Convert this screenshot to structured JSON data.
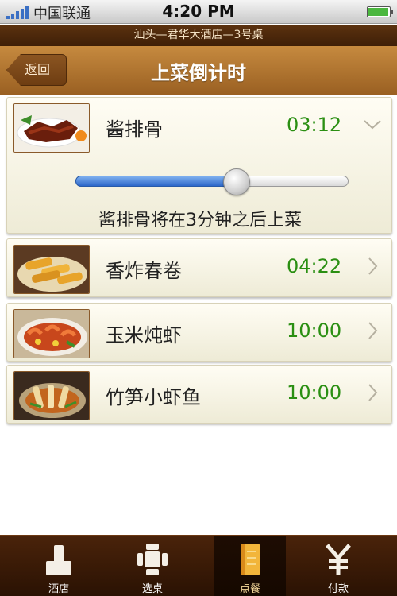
{
  "status_bar": {
    "carrier": "中国联通",
    "time": "4:20 PM"
  },
  "location": "汕头—君华大酒店—3号桌",
  "nav": {
    "back_label": "返回",
    "title": "上菜倒计时"
  },
  "dishes": [
    {
      "name": "酱排骨",
      "time": "03:12",
      "expanded": true,
      "slider_progress": 0.59,
      "note": "酱排骨将在3分钟之后上菜"
    },
    {
      "name": "香炸春卷",
      "time": "04:22"
    },
    {
      "name": "玉米炖虾",
      "time": "10:00"
    },
    {
      "name": "竹笋小虾鱼",
      "time": "10:00"
    }
  ],
  "tabs": [
    {
      "label": "酒店",
      "icon": "hotel-icon"
    },
    {
      "label": "选桌",
      "icon": "table-icon"
    },
    {
      "label": "点餐",
      "icon": "menu-icon",
      "active": true
    },
    {
      "label": "付款",
      "icon": "yen-icon"
    }
  ],
  "colors": {
    "accent_brown": "#9a6022",
    "time_green": "#2a8f12",
    "slider_blue": "#2c67c9"
  }
}
